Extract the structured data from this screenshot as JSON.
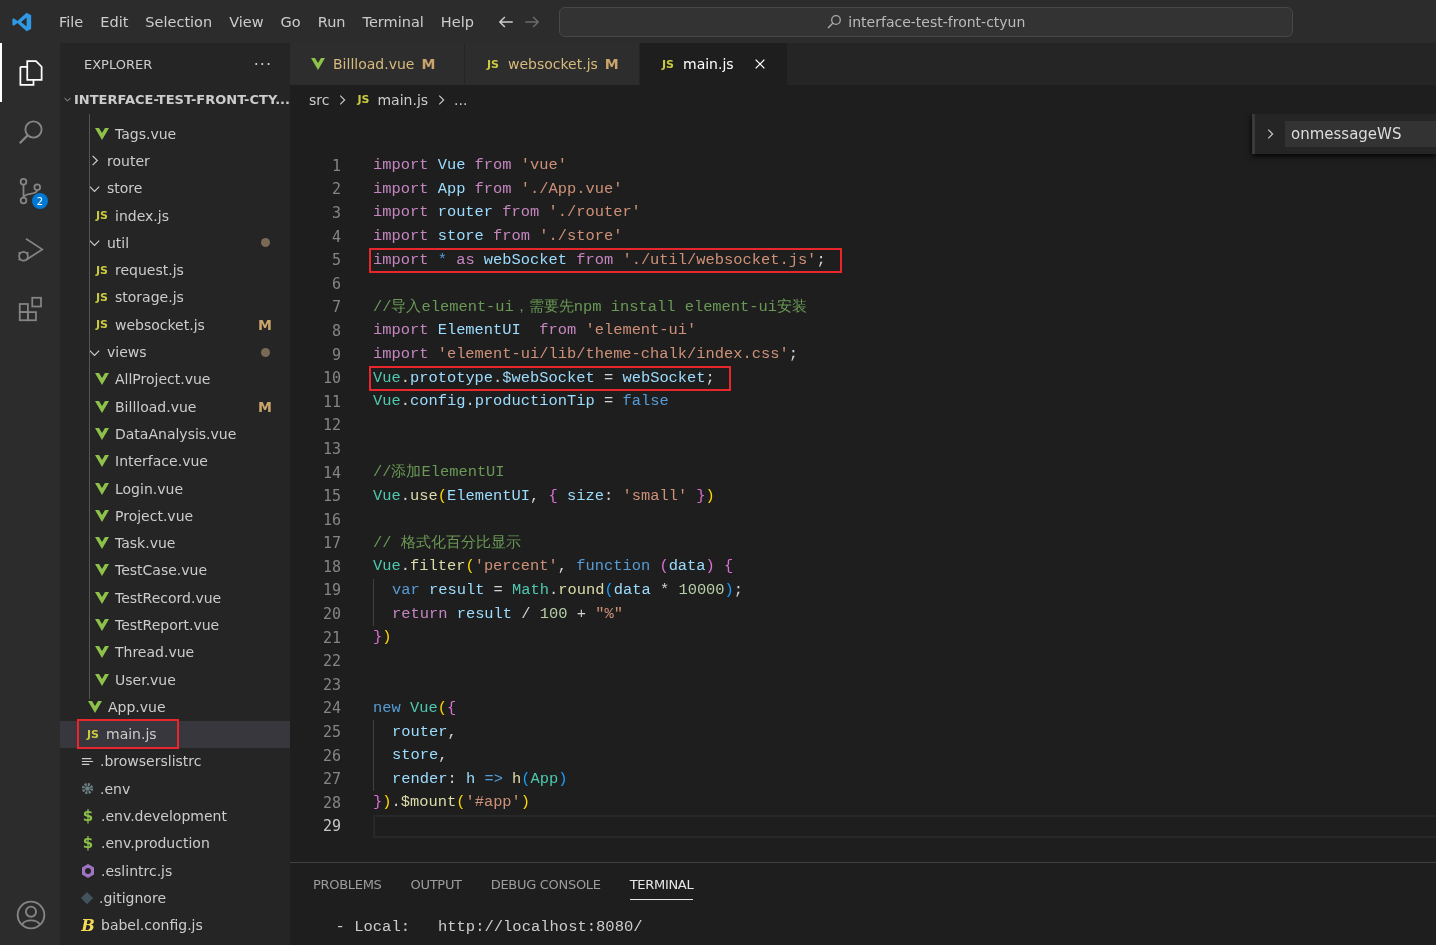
{
  "menu": [
    "File",
    "Edit",
    "Selection",
    "View",
    "Go",
    "Run",
    "Terminal",
    "Help"
  ],
  "command_center": {
    "text": "interface-test-front-ctyun"
  },
  "activity_bar": [
    {
      "kind": "explorer",
      "selected": true
    },
    {
      "kind": "search",
      "selected": false
    },
    {
      "kind": "source-control",
      "selected": false,
      "badge": "2"
    },
    {
      "kind": "debug",
      "selected": false
    },
    {
      "kind": "extensions",
      "selected": false
    },
    {
      "kind": "account",
      "selected": false
    }
  ],
  "explorer": {
    "title": "EXPLORER",
    "more": "···",
    "root": "INTERFACE-TEST-FRONT-CTY...",
    "tree": [
      {
        "children": [
          {
            "children": [
              {
                "label": "Tags.vue",
                "kind": "vue",
                "selected": false,
                "annotated": false
              }
            ]
          },
          {
            "label": "router",
            "kind": "folder",
            "expanded": false,
            "selected": false,
            "annotated": false
          },
          {
            "label": "store",
            "kind": "folder",
            "expanded": true,
            "selected": false,
            "annotated": false,
            "children": [
              {
                "label": "index.js",
                "kind": "js",
                "icon_label": "JS",
                "selected": false,
                "annotated": false
              }
            ]
          },
          {
            "label": "util",
            "kind": "folder",
            "expanded": true,
            "selected": false,
            "annotated": false,
            "dot": true,
            "children": [
              {
                "label": "request.js",
                "kind": "js",
                "icon_label": "JS",
                "selected": false,
                "annotated": false
              },
              {
                "label": "storage.js",
                "kind": "js",
                "icon_label": "JS",
                "selected": false,
                "annotated": false
              },
              {
                "label": "websocket.js",
                "kind": "js",
                "icon_label": "JS",
                "selected": false,
                "annotated": false,
                "status": "M"
              }
            ]
          },
          {
            "label": "views",
            "kind": "folder",
            "expanded": true,
            "selected": false,
            "annotated": false,
            "dot": true,
            "children": [
              {
                "label": "AllProject.vue",
                "kind": "vue",
                "selected": false,
                "annotated": false
              },
              {
                "label": "Billload.vue",
                "kind": "vue",
                "selected": false,
                "annotated": false,
                "status": "M"
              },
              {
                "label": "DataAnalysis.vue",
                "kind": "vue",
                "selected": false,
                "annotated": false
              },
              {
                "label": "Interface.vue",
                "kind": "vue",
                "selected": false,
                "annotated": false
              },
              {
                "label": "Login.vue",
                "kind": "vue",
                "selected": false,
                "annotated": false
              },
              {
                "label": "Project.vue",
                "kind": "vue",
                "selected": false,
                "annotated": false
              },
              {
                "label": "Task.vue",
                "kind": "vue",
                "selected": false,
                "annotated": false
              },
              {
                "label": "TestCase.vue",
                "kind": "vue",
                "selected": false,
                "annotated": false
              },
              {
                "label": "TestRecord.vue",
                "kind": "vue",
                "selected": false,
                "annotated": false
              },
              {
                "label": "TestReport.vue",
                "kind": "vue",
                "selected": false,
                "annotated": false
              },
              {
                "label": "Thread.vue",
                "kind": "vue",
                "selected": false,
                "annotated": false
              },
              {
                "label": "User.vue",
                "kind": "vue",
                "selected": false,
                "annotated": false
              }
            ]
          },
          {
            "label": "App.vue",
            "kind": "vue",
            "selected": false,
            "annotated": false
          },
          {
            "label": "main.js",
            "kind": "js",
            "icon_label": "JS",
            "selected": true,
            "annotated": true
          }
        ]
      },
      {
        "label": ".browserslistrc",
        "kind": "lines",
        "selected": false,
        "annotated": false
      },
      {
        "label": ".env",
        "kind": "gear",
        "selected": false,
        "annotated": false
      },
      {
        "label": ".env.development",
        "kind": "dollar",
        "icon_label": "$",
        "selected": false,
        "annotated": false
      },
      {
        "label": ".env.production",
        "kind": "dollar",
        "icon_label": "$",
        "selected": false,
        "annotated": false
      },
      {
        "label": ".eslintrc.js",
        "kind": "eslint",
        "selected": false,
        "annotated": false
      },
      {
        "label": ".gitignore",
        "kind": "git",
        "selected": false,
        "annotated": false
      },
      {
        "label": "babel.config.js",
        "kind": "babel",
        "icon_label": "B",
        "selected": false,
        "annotated": false
      }
    ]
  },
  "tabs": [
    {
      "label": "Billload.vue",
      "kind": "vue",
      "status": "M",
      "selected": false
    },
    {
      "label": "websocket.js",
      "kind": "js",
      "icon_label": "JS",
      "status": "M",
      "selected": false
    },
    {
      "label": "main.js",
      "kind": "js",
      "icon_label": "JS",
      "selected": true
    }
  ],
  "breadcrumb": [
    {
      "label": "src"
    },
    {
      "label": "main.js",
      "icon_label": "JS"
    },
    {
      "label": "..."
    }
  ],
  "sticky_outline": {
    "label": "onmessageWS",
    "expanded": false
  },
  "code": [
    {
      "number": "1",
      "tokens": [
        {
          "kind": "kw",
          "text": "import "
        },
        {
          "kind": "id",
          "text": "Vue "
        },
        {
          "kind": "kw",
          "text": "from "
        },
        {
          "kind": "str",
          "text": "'vue'"
        }
      ]
    },
    {
      "number": "2",
      "tokens": [
        {
          "kind": "kw",
          "text": "import "
        },
        {
          "kind": "id",
          "text": "App "
        },
        {
          "kind": "kw",
          "text": "from "
        },
        {
          "kind": "str",
          "text": "'./App.vue'"
        }
      ]
    },
    {
      "number": "3",
      "tokens": [
        {
          "kind": "kw",
          "text": "import "
        },
        {
          "kind": "id",
          "text": "router "
        },
        {
          "kind": "kw",
          "text": "from "
        },
        {
          "kind": "str",
          "text": "'./router'"
        }
      ]
    },
    {
      "number": "4",
      "tokens": [
        {
          "kind": "kw",
          "text": "import "
        },
        {
          "kind": "id",
          "text": "store "
        },
        {
          "kind": "kw",
          "text": "from "
        },
        {
          "kind": "str",
          "text": "'./store'"
        }
      ]
    },
    {
      "number": "5",
      "annotated": true,
      "tokens": [
        {
          "kind": "kw",
          "text": "import "
        },
        {
          "kind": "decl",
          "text": "* "
        },
        {
          "kind": "kw",
          "text": "as "
        },
        {
          "kind": "id",
          "text": "webSocket "
        },
        {
          "kind": "kw",
          "text": "from "
        },
        {
          "kind": "str",
          "text": "'./util/websocket.js'"
        },
        {
          "kind": "plain",
          "text": ";"
        }
      ]
    },
    {
      "number": "6"
    },
    {
      "number": "7",
      "tokens": [
        {
          "kind": "com",
          "text": "//导入element-ui，需要先npm install element-ui安装"
        }
      ]
    },
    {
      "number": "8",
      "tokens": [
        {
          "kind": "kw",
          "text": "import "
        },
        {
          "kind": "id",
          "text": "ElementUI  "
        },
        {
          "kind": "kw",
          "text": "from "
        },
        {
          "kind": "str",
          "text": "'element-ui'"
        }
      ]
    },
    {
      "number": "9",
      "tokens": [
        {
          "kind": "kw",
          "text": "import "
        },
        {
          "kind": "str",
          "text": "'element-ui/lib/theme-chalk/index.css'"
        },
        {
          "kind": "plain",
          "text": ";"
        }
      ]
    },
    {
      "number": "10",
      "annotated": true,
      "tokens": [
        {
          "kind": "cls",
          "text": "Vue"
        },
        {
          "kind": "plain",
          "text": "."
        },
        {
          "kind": "id",
          "text": "prototype"
        },
        {
          "kind": "plain",
          "text": "."
        },
        {
          "kind": "id",
          "text": "$webSocket "
        },
        {
          "kind": "plain",
          "text": "= "
        },
        {
          "kind": "id",
          "text": "webSocket"
        },
        {
          "kind": "plain",
          "text": ";"
        }
      ]
    },
    {
      "number": "11",
      "tokens": [
        {
          "kind": "cls",
          "text": "Vue"
        },
        {
          "kind": "plain",
          "text": "."
        },
        {
          "kind": "id",
          "text": "config"
        },
        {
          "kind": "plain",
          "text": "."
        },
        {
          "kind": "id",
          "text": "productionTip "
        },
        {
          "kind": "plain",
          "text": "= "
        },
        {
          "kind": "decl",
          "text": "false"
        }
      ]
    },
    {
      "number": "12"
    },
    {
      "number": "13"
    },
    {
      "number": "14",
      "tokens": [
        {
          "kind": "com",
          "text": "//添加ElementUI"
        }
      ]
    },
    {
      "number": "15",
      "tokens": [
        {
          "kind": "cls",
          "text": "Vue"
        },
        {
          "kind": "plain",
          "text": "."
        },
        {
          "kind": "fn",
          "text": "use"
        },
        {
          "kind": "b1",
          "text": "("
        },
        {
          "kind": "id",
          "text": "ElementUI"
        },
        {
          "kind": "plain",
          "text": ", "
        },
        {
          "kind": "b2",
          "text": "{ "
        },
        {
          "kind": "id",
          "text": "size"
        },
        {
          "kind": "plain",
          "text": ": "
        },
        {
          "kind": "str",
          "text": "'small' "
        },
        {
          "kind": "b2",
          "text": "}"
        },
        {
          "kind": "b1",
          "text": ")"
        }
      ]
    },
    {
      "number": "16"
    },
    {
      "number": "17",
      "tokens": [
        {
          "kind": "com",
          "text": "// 格式化百分比显示"
        }
      ]
    },
    {
      "number": "18",
      "tokens": [
        {
          "kind": "cls",
          "text": "Vue"
        },
        {
          "kind": "plain",
          "text": "."
        },
        {
          "kind": "fn",
          "text": "filter"
        },
        {
          "kind": "b1",
          "text": "("
        },
        {
          "kind": "str",
          "text": "'percent'"
        },
        {
          "kind": "plain",
          "text": ", "
        },
        {
          "kind": "decl",
          "text": "function "
        },
        {
          "kind": "b2",
          "text": "("
        },
        {
          "kind": "id",
          "text": "data"
        },
        {
          "kind": "b2",
          "text": ") {"
        }
      ]
    },
    {
      "number": "19",
      "indented": true,
      "tokens": [
        {
          "kind": "decl",
          "text": "var "
        },
        {
          "kind": "id",
          "text": "result "
        },
        {
          "kind": "plain",
          "text": "= "
        },
        {
          "kind": "cls",
          "text": "Math"
        },
        {
          "kind": "plain",
          "text": "."
        },
        {
          "kind": "fn",
          "text": "round"
        },
        {
          "kind": "b3",
          "text": "("
        },
        {
          "kind": "id",
          "text": "data "
        },
        {
          "kind": "plain",
          "text": "* "
        },
        {
          "kind": "num",
          "text": "10000"
        },
        {
          "kind": "b3",
          "text": ")"
        },
        {
          "kind": "plain",
          "text": ";"
        }
      ]
    },
    {
      "number": "20",
      "indented": true,
      "tokens": [
        {
          "kind": "kw",
          "text": "return "
        },
        {
          "kind": "id",
          "text": "result "
        },
        {
          "kind": "plain",
          "text": "/ "
        },
        {
          "kind": "num",
          "text": "100 "
        },
        {
          "kind": "plain",
          "text": "+ "
        },
        {
          "kind": "str",
          "text": "\"%\""
        }
      ]
    },
    {
      "number": "21",
      "tokens": [
        {
          "kind": "b2",
          "text": "}"
        },
        {
          "kind": "b1",
          "text": ")"
        }
      ]
    },
    {
      "number": "22"
    },
    {
      "number": "23"
    },
    {
      "number": "24",
      "tokens": [
        {
          "kind": "decl",
          "text": "new "
        },
        {
          "kind": "cls",
          "text": "Vue"
        },
        {
          "kind": "b1",
          "text": "("
        },
        {
          "kind": "b2",
          "text": "{"
        }
      ]
    },
    {
      "number": "25",
      "indented": true,
      "tokens": [
        {
          "kind": "id",
          "text": "router"
        },
        {
          "kind": "plain",
          "text": ","
        }
      ]
    },
    {
      "number": "26",
      "indented": true,
      "tokens": [
        {
          "kind": "id",
          "text": "store"
        },
        {
          "kind": "plain",
          "text": ","
        }
      ]
    },
    {
      "number": "27",
      "indented": true,
      "tokens": [
        {
          "kind": "id",
          "text": "render"
        },
        {
          "kind": "plain",
          "text": ": "
        },
        {
          "kind": "id",
          "text": "h "
        },
        {
          "kind": "decl",
          "text": "=> "
        },
        {
          "kind": "fn",
          "text": "h"
        },
        {
          "kind": "b3",
          "text": "("
        },
        {
          "kind": "cls",
          "text": "App"
        },
        {
          "kind": "b3",
          "text": ")"
        }
      ]
    },
    {
      "number": "28",
      "tokens": [
        {
          "kind": "b2",
          "text": "}"
        },
        {
          "kind": "b1",
          "text": ")"
        },
        {
          "kind": "plain",
          "text": "."
        },
        {
          "kind": "fn",
          "text": "$mount"
        },
        {
          "kind": "b1",
          "text": "("
        },
        {
          "kind": "str",
          "text": "'#app'"
        },
        {
          "kind": "b1",
          "text": ")"
        }
      ]
    },
    {
      "number": "29",
      "current": true
    }
  ],
  "panel": {
    "tabs": [
      {
        "label": "PROBLEMS",
        "selected": false
      },
      {
        "label": "OUTPUT",
        "selected": false
      },
      {
        "label": "DEBUG CONSOLE",
        "selected": false
      },
      {
        "label": "TERMINAL",
        "selected": true
      }
    ],
    "terminal_lines": [
      "  - Local:   http://localhost:8080/"
    ]
  }
}
